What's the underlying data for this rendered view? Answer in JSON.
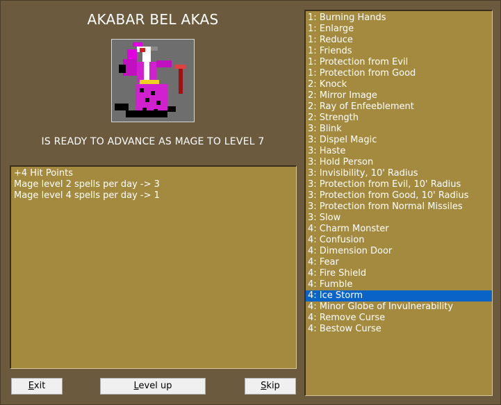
{
  "character": {
    "name": "AKABAR BEL AKAS",
    "status": "IS READY TO ADVANCE AS MAGE TO LEVEL 7"
  },
  "gains": [
    "+4 Hit Points",
    "Mage level 2 spells per day -> 3",
    "Mage level 4 spells per day -> 1"
  ],
  "buttons": {
    "exit_first": "E",
    "exit_rest": "xit",
    "level_first": "L",
    "level_rest": "evel up",
    "skip_first": "S",
    "skip_rest": "kip"
  },
  "spells": [
    "1: Burning Hands",
    "1: Enlarge",
    "1: Reduce",
    "1: Friends",
    "1: Protection from Evil",
    "1: Protection from Good",
    "2: Knock",
    "2: Mirror Image",
    "2: Ray of Enfeeblement",
    "2: Strength",
    "3: Blink",
    "3: Dispel Magic",
    "3: Haste",
    "3: Hold Person",
    "3: Invisibility, 10' Radius",
    "3: Protection from Evil, 10' Radius",
    "3: Protection from Good, 10' Radius",
    "3: Protection from Normal Missiles",
    "3: Slow",
    "4: Charm Monster",
    "4: Confusion",
    "4: Dimension Door",
    "4: Fear",
    "4: Fire Shield",
    "4: Fumble",
    "4: Ice Storm",
    "4: Minor Globe of Invulnerability",
    "4: Remove Curse",
    "4: Bestow Curse"
  ],
  "selected_spell": "4: Ice Storm",
  "colors": {
    "background": "#6b5a3e",
    "panel": "#a48a3e",
    "selection": "#0a64c8",
    "robe": "#d020d0"
  }
}
